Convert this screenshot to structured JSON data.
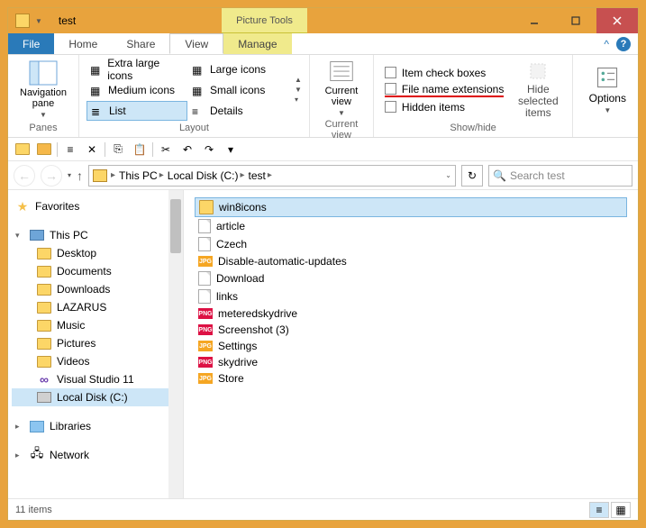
{
  "titlebar": {
    "title": "test",
    "context_tab": "Picture Tools"
  },
  "ribbon_tabs": {
    "file": "File",
    "home": "Home",
    "share": "Share",
    "view": "View",
    "manage": "Manage"
  },
  "ribbon": {
    "panes": {
      "nav_pane": "Navigation pane",
      "label": "Panes"
    },
    "layout": {
      "xl": "Extra large icons",
      "lg": "Large icons",
      "md": "Medium icons",
      "sm": "Small icons",
      "list": "List",
      "details": "Details",
      "label": "Layout"
    },
    "current_view": {
      "btn": "Current view",
      "label": "Current view"
    },
    "showhide": {
      "item_check": "Item check boxes",
      "file_ext": "File name extensions",
      "hidden": "Hidden items",
      "hide_selected": "Hide selected items",
      "label": "Show/hide"
    },
    "options": "Options"
  },
  "breadcrumbs": [
    "This PC",
    "Local Disk (C:)",
    "test"
  ],
  "search": {
    "placeholder": "Search test"
  },
  "tree": {
    "favorites": "Favorites",
    "this_pc": "This PC",
    "pc_children": [
      "Desktop",
      "Documents",
      "Downloads",
      "LAZARUS",
      "Music",
      "Pictures",
      "Videos",
      "Visual Studio 11",
      "Local Disk (C:)"
    ],
    "libraries": "Libraries",
    "network": "Network"
  },
  "files": [
    {
      "name": "win8icons",
      "type": "folder",
      "selected": true
    },
    {
      "name": "article",
      "type": "doc"
    },
    {
      "name": "Czech",
      "type": "doc"
    },
    {
      "name": "Disable-automatic-updates",
      "type": "jpg"
    },
    {
      "name": "Download",
      "type": "doc"
    },
    {
      "name": "links",
      "type": "doc"
    },
    {
      "name": "meteredskydrive",
      "type": "png"
    },
    {
      "name": "Screenshot (3)",
      "type": "png"
    },
    {
      "name": "Settings",
      "type": "jpg"
    },
    {
      "name": "skydrive",
      "type": "png"
    },
    {
      "name": "Store",
      "type": "jpg"
    }
  ],
  "statusbar": {
    "count": "11 items"
  }
}
